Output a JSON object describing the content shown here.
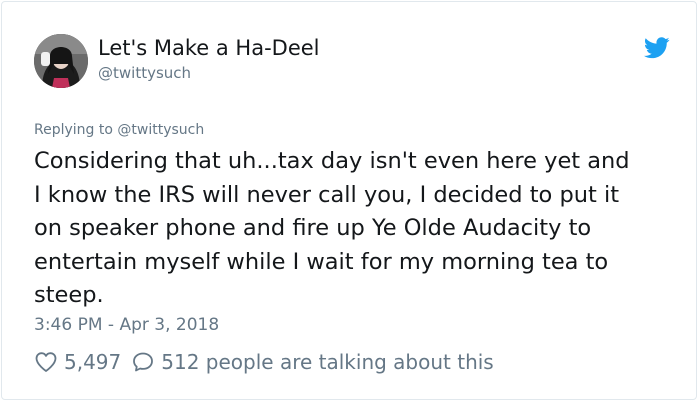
{
  "author": {
    "display_name": "Let's Make a Ha-Deel",
    "handle": "@twittysuch",
    "avatar_icon": "profile-photo"
  },
  "platform_icon": "twitter-bird-icon",
  "reply_context": {
    "prefix": "Replying to",
    "handle": "@twittysuch"
  },
  "tweet": {
    "lines": [
      "Considering that uh...tax day isn't even here yet and",
      "I know the IRS will never call you, I decided to put it",
      "on speaker phone and fire up Ye Olde Audacity to",
      "entertain myself while I wait for my morning tea to",
      "steep."
    ],
    "timestamp": "3:46 PM - Apr 3, 2018"
  },
  "engagement": {
    "likes": "5,497",
    "replies_text": "512 people are talking about this"
  },
  "colors": {
    "twitter_blue": "#1da1f2",
    "text_primary": "#14171a",
    "text_secondary": "#657786",
    "border": "#e1e8ed"
  }
}
